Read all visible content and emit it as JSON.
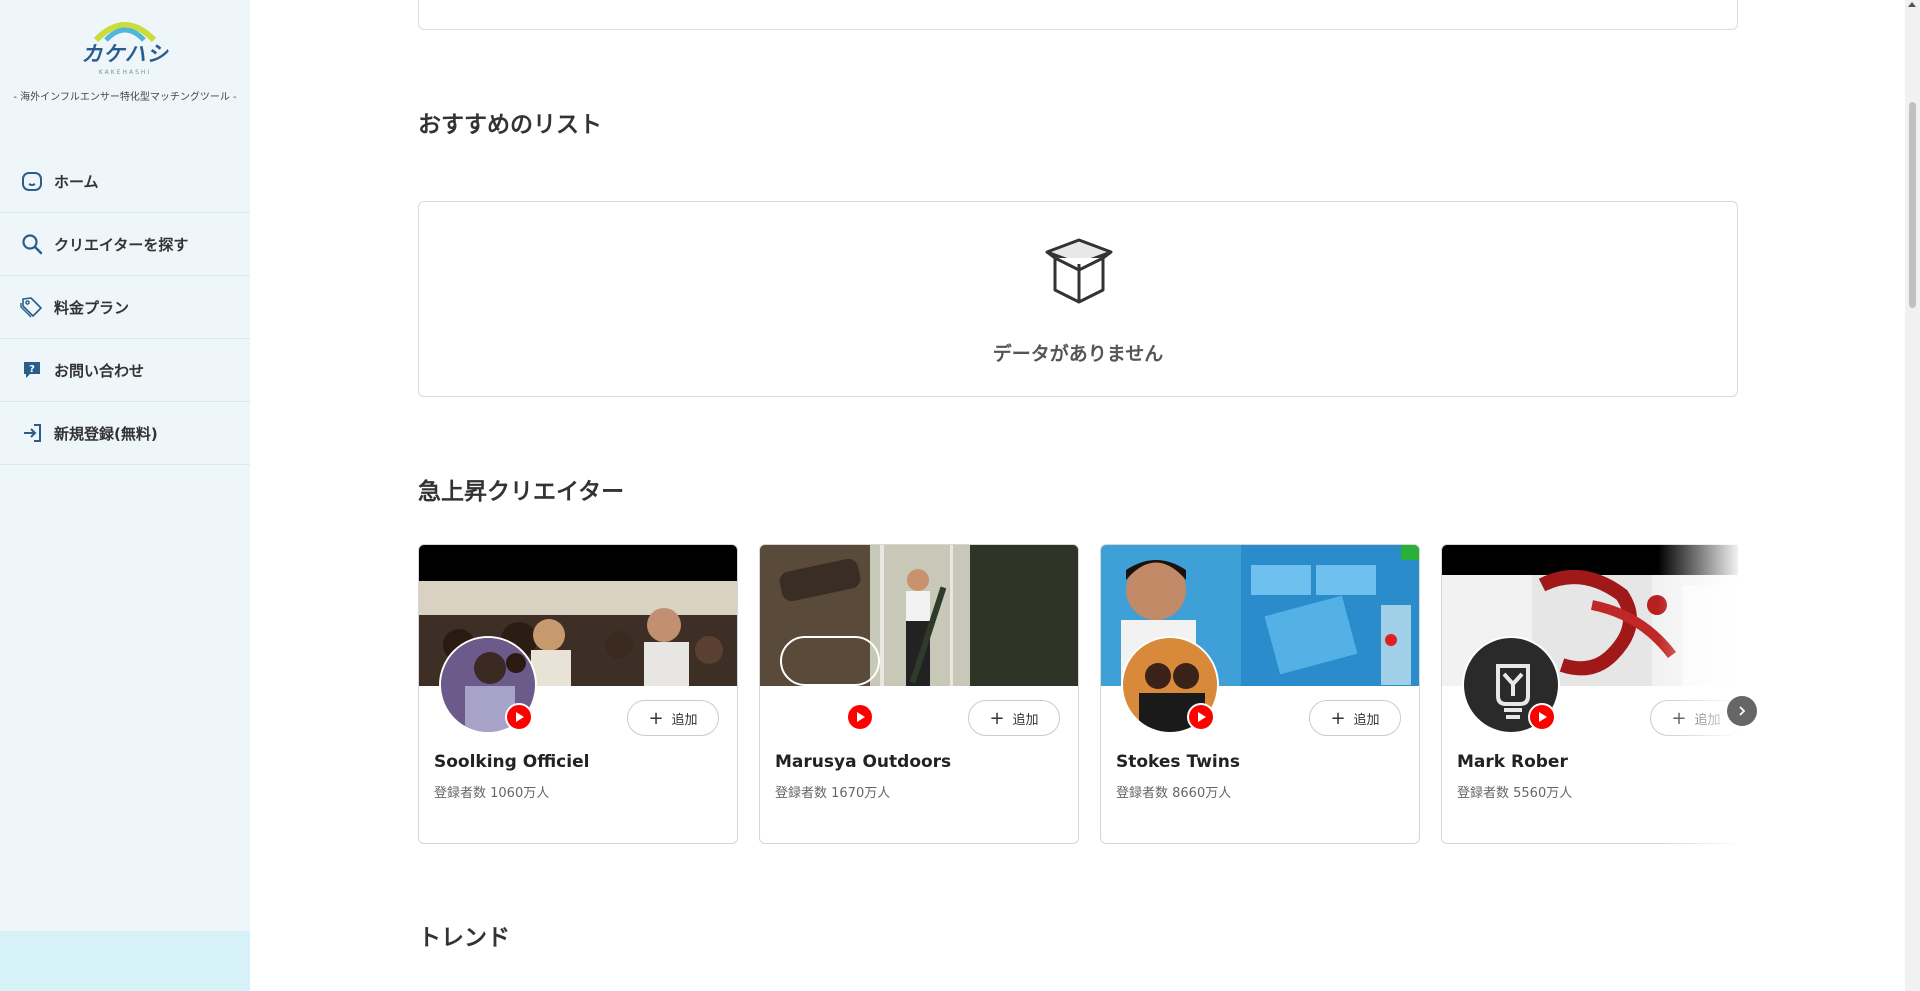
{
  "sidebar": {
    "logo_text": "カケハシ",
    "logo_sub": "KAKEHASHI",
    "tagline": "- 海外インフルエンサー特化型マッチングツール -",
    "items": [
      {
        "label": "ホーム",
        "icon": "home-icon"
      },
      {
        "label": "クリエイターを探す",
        "icon": "search-icon"
      },
      {
        "label": "料金プラン",
        "icon": "price-tag-icon"
      },
      {
        "label": "お問い合わせ",
        "icon": "help-chat-icon"
      },
      {
        "label": "新規登録(無料)",
        "icon": "sign-in-icon"
      }
    ]
  },
  "main": {
    "recommended": {
      "title": "おすすめのリスト",
      "empty_text": "データがありません"
    },
    "rising": {
      "title": "急上昇クリエイター",
      "add_label": "追加",
      "creators": [
        {
          "name": "Soolking Officiel",
          "subscribers": "登録者数 1060万人"
        },
        {
          "name": "Marusya Outdoors",
          "subscribers": "登録者数 1670万人"
        },
        {
          "name": "Stokes Twins",
          "subscribers": "登録者数 8660万人"
        },
        {
          "name": "Mark Rober",
          "subscribers": "登録者数 5560万人"
        }
      ]
    },
    "trend": {
      "title": "トレンド"
    }
  },
  "colors": {
    "sidebar_bg": "#eef6fa",
    "sidebar_bottom": "#d6f1f8",
    "youtube_red": "#ff0000",
    "nav_icon": "#2a5d8c"
  }
}
